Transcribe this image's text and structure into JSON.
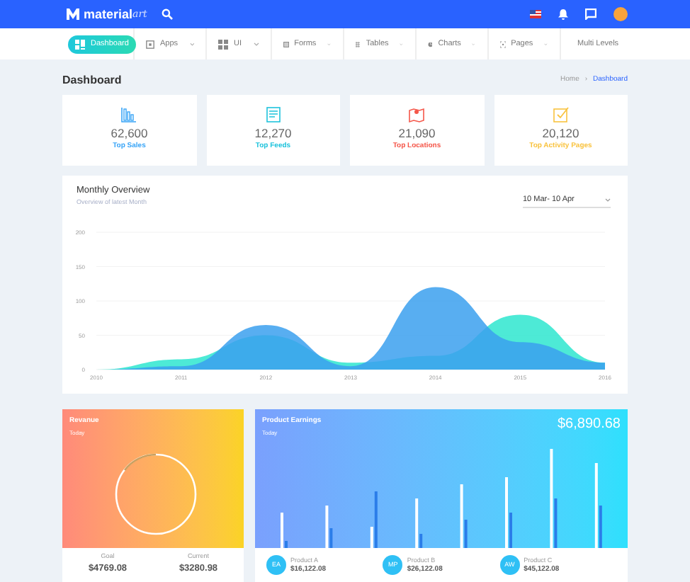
{
  "header": {
    "logo": "material",
    "logo_accent": "art"
  },
  "nav": [
    {
      "label": "Dashboard",
      "selected": true,
      "caret": false
    },
    {
      "label": "Apps",
      "selected": false,
      "caret": true
    },
    {
      "label": "UI",
      "selected": false,
      "caret": true
    },
    {
      "label": "Forms",
      "selected": false,
      "caret": true
    },
    {
      "label": "Tables",
      "selected": false,
      "caret": true
    },
    {
      "label": "Charts",
      "selected": false,
      "caret": true
    },
    {
      "label": "Pages",
      "selected": false,
      "caret": true
    },
    {
      "label": "Multi Levels",
      "selected": false,
      "caret": false
    }
  ],
  "page_title": "Dashboard",
  "breadcrumb": {
    "separator": "›",
    "items": [
      {
        "label": "Home",
        "selected": false
      },
      {
        "label": "Dashboard",
        "selected": true
      }
    ]
  },
  "stats": [
    {
      "value": "62,600",
      "label": "Top Sales",
      "color": "#3aa5f7"
    },
    {
      "value": "12,270",
      "label": "Top Feeds",
      "color": "#1fc3dc"
    },
    {
      "value": "21,090",
      "label": "Top Locations",
      "color": "#f5574a"
    },
    {
      "value": "20,120",
      "label": "Top Activity Pages",
      "color": "#f9c33f"
    }
  ],
  "overview": {
    "title": "Monthly Overview",
    "subtitle": "Overview of latest Month",
    "date_range": {
      "value": "10 Mar- 10 Apr"
    },
    "chart_data": {
      "type": "area",
      "x": [
        2010,
        2011,
        2012,
        2013,
        2014,
        2015,
        2016
      ],
      "series": [
        {
          "color": "#2ee6cf",
          "values": [
            0,
            15,
            50,
            10,
            20,
            80,
            10
          ]
        },
        {
          "color": "#3ba0ee",
          "values": [
            0,
            5,
            65,
            5,
            120,
            40,
            10
          ]
        }
      ],
      "xlim": [
        2010,
        2016
      ],
      "grid": true,
      "ylim": [
        0,
        200
      ],
      "yticks": [
        0,
        50,
        100,
        150,
        200
      ],
      "xticks": [
        2010,
        2011,
        2012,
        2013,
        2014,
        2015,
        2016
      ]
    }
  },
  "revenue": {
    "title": "Revanue",
    "subtitle": "Today",
    "goal_label": "Goal",
    "goal_value": "$4769.08",
    "current_label": "Current",
    "current_value": "$3280.98"
  },
  "earnings": {
    "title": "Product Earnings",
    "subtitle": "Today",
    "total": "$6,890.68",
    "products": [
      {
        "initials": "EA",
        "name": "Product A",
        "amount": "$16,122.08"
      },
      {
        "initials": "MP",
        "name": "Product B",
        "amount": "$26,122.08"
      },
      {
        "initials": "AW",
        "name": "Product C",
        "amount": "$45,122.08"
      }
    ]
  }
}
